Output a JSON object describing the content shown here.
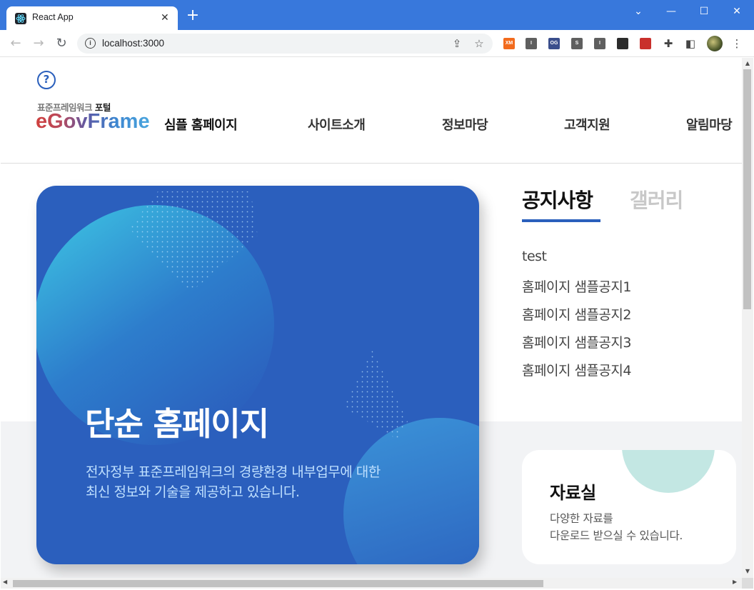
{
  "browser": {
    "tab_title": "React App",
    "tab_close": "✕",
    "new_tab": "+",
    "url": "localhost:3000",
    "window_controls": [
      "⌄",
      "—",
      "☐",
      "✕"
    ],
    "extensions": [
      {
        "name": "xmind-extension",
        "label": "XM",
        "color": "#f26b1d"
      },
      {
        "name": "extension-i-1",
        "label": "I",
        "color": "#5f5f5f"
      },
      {
        "name": "og-extension",
        "label": "OG",
        "color": "#3a4e8c"
      },
      {
        "name": "s-extension",
        "label": "S",
        "color": "#5f5f5f"
      },
      {
        "name": "extension-i-2",
        "label": "I",
        "color": "#5f5f5f"
      },
      {
        "name": "dark-extension",
        "label": "",
        "color": "#2b2b2b"
      },
      {
        "name": "red-extension",
        "label": "",
        "color": "#c9302c"
      }
    ]
  },
  "header": {
    "help": "?",
    "logo_sub_prefix": "표준프레임워크",
    "logo_sub_suffix": "포털",
    "logo_main": "eGovFrame",
    "logo_tag": "심플 홈페이지",
    "nav": [
      "사이트소개",
      "정보마당",
      "고객지원",
      "알림마당"
    ]
  },
  "hero": {
    "title": "단순 홈페이지",
    "desc_line1": "전자정부 표준프레임워크의 경량환경 내부업무에 대한",
    "desc_line2": "최신 정보와 기술을 제공하고 있습니다."
  },
  "board": {
    "tabs": [
      "공지사항",
      "갤러리"
    ],
    "active_tab": "공지사항",
    "notices": [
      "test",
      "홈페이지 샘플공지1",
      "홈페이지 샘플공지2",
      "홈페이지 샘플공지3",
      "홈페이지 샘플공지4"
    ]
  },
  "archive": {
    "title": "자료실",
    "desc_line1": "다양한 자료를",
    "desc_line2": "다운로드 받으실 수 있습니다."
  },
  "colors": {
    "chrome_blue": "#3878dc",
    "brand_blue": "#2a5fbc",
    "hero_blue": "#2b5fbd",
    "hero_text": "#bfe0ff",
    "accent_teal": "#c3e7e3"
  }
}
